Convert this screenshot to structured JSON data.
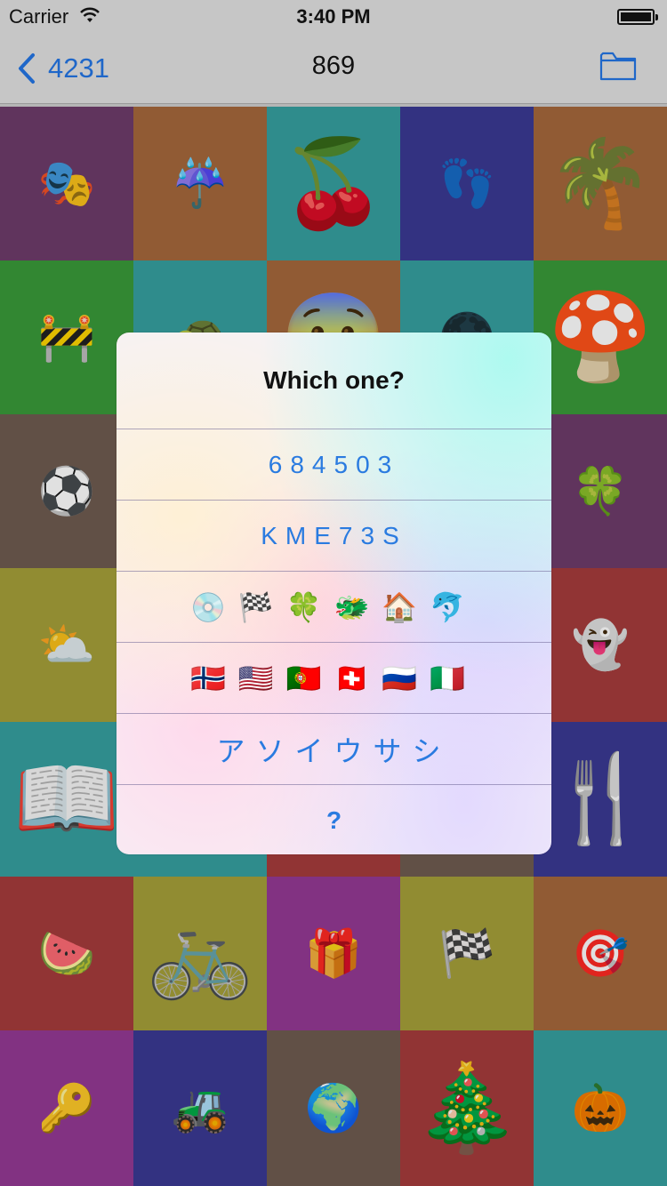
{
  "status": {
    "carrier": "Carrier",
    "time": "3:40 PM",
    "battery_level": 1.0
  },
  "nav": {
    "back_label": "4231",
    "title": "869"
  },
  "alert": {
    "title": "Which one?",
    "options": [
      "684503",
      "KME73S",
      "💿🏁🍀🐲🏠🐬",
      "🇳🇴🇺🇸🇵🇹🇨🇭🇷🇺🇮🇹",
      "アソイウサシ",
      "?"
    ]
  },
  "tiles": [
    {
      "emoji": "🎭",
      "color": "#6e3c6a"
    },
    {
      "emoji": "☔",
      "color": "#a5683c"
    },
    {
      "emoji": "🍒",
      "color": "#36a0a0"
    },
    {
      "emoji": "👣",
      "color": "#3b3a93"
    },
    {
      "emoji": "🌴",
      "color": "#a5683c"
    },
    {
      "emoji": "🚧",
      "color": "#3a9a3a"
    },
    {
      "emoji": "🐢",
      "color": "#36a0a0"
    },
    {
      "emoji": "😨",
      "color": "#a5683c"
    },
    {
      "emoji": "🌑",
      "color": "#36a0a0"
    },
    {
      "emoji": "🍄",
      "color": "#3a9a3a"
    },
    {
      "emoji": "⚽",
      "color": "#6f5c50"
    },
    {
      "emoji": "",
      "color": "#6f5c50"
    },
    {
      "emoji": "",
      "color": "#6f5c50"
    },
    {
      "emoji": "",
      "color": "#6f5c50"
    },
    {
      "emoji": "🍀",
      "color": "#6e3c6a"
    },
    {
      "emoji": "⛅",
      "color": "#a6a03a"
    },
    {
      "emoji": "",
      "color": "#a6a03a"
    },
    {
      "emoji": "",
      "color": "#a53c3c"
    },
    {
      "emoji": "",
      "color": "#a53c3c"
    },
    {
      "emoji": "👻",
      "color": "#a53c3c"
    },
    {
      "emoji": "📖",
      "color": "#36a0a0"
    },
    {
      "emoji": "",
      "color": "#36a0a0"
    },
    {
      "emoji": "",
      "color": "#a53c3c"
    },
    {
      "emoji": "",
      "color": "#6f5c50"
    },
    {
      "emoji": "🍴",
      "color": "#3b3a93"
    },
    {
      "emoji": "🍉",
      "color": "#a53c3c"
    },
    {
      "emoji": "🚲",
      "color": "#a6a03a"
    },
    {
      "emoji": "🎁",
      "color": "#943a94"
    },
    {
      "emoji": "🏁",
      "color": "#a6a03a"
    },
    {
      "emoji": "🎯",
      "color": "#a5683c"
    },
    {
      "emoji": "🔑",
      "color": "#943a94"
    },
    {
      "emoji": "🚜",
      "color": "#3b3a93"
    },
    {
      "emoji": "🌍",
      "color": "#6f5c50"
    },
    {
      "emoji": "🎄",
      "color": "#a53c3c"
    },
    {
      "emoji": "🎃",
      "color": "#36a0a0"
    }
  ],
  "icons": {
    "back": "chevron-left-icon",
    "folder": "folder-icon",
    "wifi": "wifi-icon",
    "battery": "battery-icon"
  }
}
